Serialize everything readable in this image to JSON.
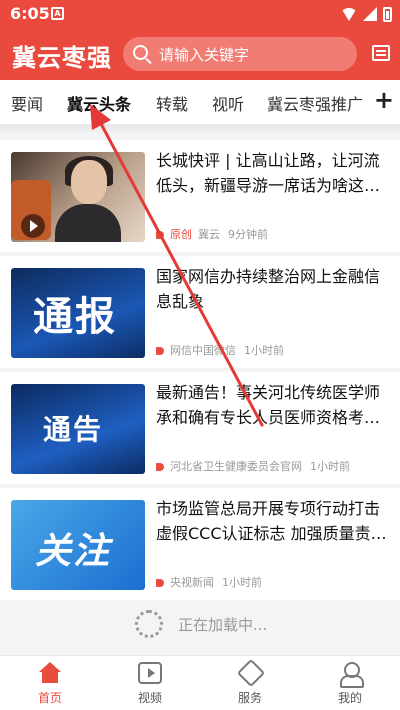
{
  "status": {
    "time": "6:05",
    "app_badge": "A"
  },
  "header": {
    "logo": "冀云枣强",
    "search_placeholder": "请输入关键字"
  },
  "tabs": [
    "要闻",
    "冀云头条",
    "转载",
    "视听",
    "冀云枣强推广"
  ],
  "active_tab": "冀云头条",
  "news": [
    {
      "title": "长城快评 | 让高山让路，让河流低头，新疆导游一席话为啥这…",
      "tag": "原创",
      "source": "冀云",
      "time": "9分钟前",
      "thumb_text": ""
    },
    {
      "title": "国家网信办持续整治网上金融信息乱象",
      "tag": "",
      "source": "网信中国微信",
      "time": "1小时前",
      "thumb_text": "通报"
    },
    {
      "title": "最新通告！事关河北传统医学师承和确有专长人员医师资格考…",
      "tag": "",
      "source": "河北省卫生健康委员会官网",
      "time": "1小时前",
      "thumb_text": "通告"
    },
    {
      "title": "市场监管总局开展专项行动打击虚假CCC认证标志 加强质量责…",
      "tag": "",
      "source": "央视新闻",
      "time": "1小时前",
      "thumb_text": "关注"
    }
  ],
  "loading_text": "正在加载中...",
  "bottom_nav": [
    {
      "label": "首页",
      "icon": "home-icon",
      "active": true
    },
    {
      "label": "视频",
      "icon": "video-icon",
      "active": false
    },
    {
      "label": "服务",
      "icon": "service-icon",
      "active": false
    },
    {
      "label": "我的",
      "icon": "profile-icon",
      "active": false
    }
  ],
  "colors": {
    "brand": "#ea4a3e",
    "accent": "#e84c3d",
    "arrow": "#e53935"
  }
}
